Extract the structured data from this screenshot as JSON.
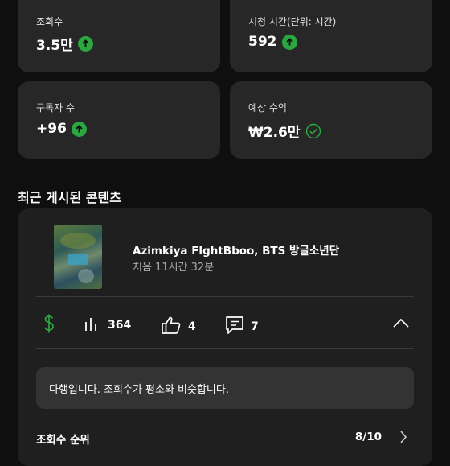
{
  "metrics": [
    {
      "label": "조회수",
      "value": "3.5만",
      "indicator": "up-arrow"
    },
    {
      "label": "시청 시간(단위: 시간)",
      "value": "592",
      "indicator": "up-arrow"
    },
    {
      "label": "구독자 수",
      "value": "+96",
      "indicator": "up-arrow"
    },
    {
      "label": "예상 수익",
      "value": "₩2.6만",
      "indicator": "check"
    }
  ],
  "section_title": "최근 게시된 콘텐츠",
  "video": {
    "title": "Azimkiya FlghtBboo,  BTS 방글소년단",
    "subtitle": "처음 11시간 32분"
  },
  "stats": {
    "views": "364",
    "likes": "4",
    "comments": "7"
  },
  "notice": "다행입니다. 조회수가 평소와 비슷합니다.",
  "rank": {
    "label": "조회수 순위",
    "value": "8/10"
  },
  "colors": {
    "up": "#2ba640",
    "money": "#2ba640",
    "card": "#272727",
    "background": "#0f0f0f"
  }
}
